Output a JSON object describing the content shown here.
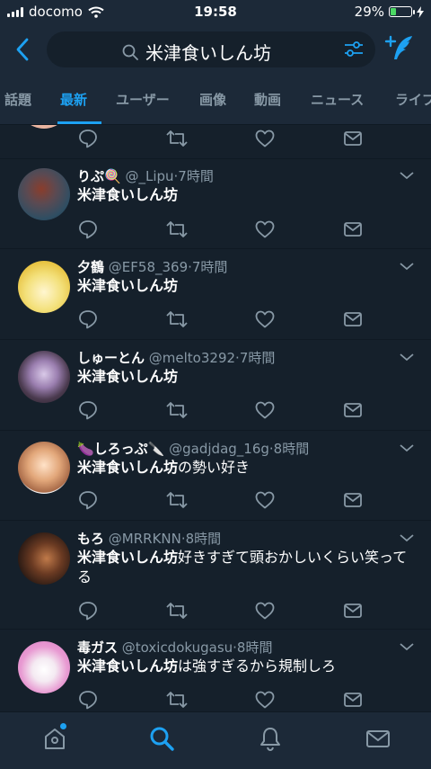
{
  "status": {
    "carrier": "docomo",
    "time": "19:58",
    "battery": "29%"
  },
  "search": {
    "query": "米津食いしん坊"
  },
  "tabs": [
    "話題",
    "最新",
    "ユーザー",
    "画像",
    "動画",
    "ニュース",
    "ライブ"
  ],
  "active_tab": "最新",
  "tweets": [
    {
      "name": "りぷ🍭",
      "handle": "@_Lipu",
      "time": "·7時間",
      "bold": "米津食いしん坊",
      "rest": ""
    },
    {
      "name": "夕鶴",
      "handle": "@EF58_369",
      "time": "·7時間",
      "bold": "米津食いしん坊",
      "rest": ""
    },
    {
      "name": "しゅーとん",
      "handle": "@melto3292",
      "time": "·7時間",
      "bold": "米津食いしん坊",
      "rest": ""
    },
    {
      "name": "🍆しろっぷ🔪",
      "handle": "@gadjdag_16g",
      "time": "·8時間",
      "bold": "米津食いしん坊",
      "rest": "の勢い好き"
    },
    {
      "name": "もろ",
      "handle": "@MRRKNN",
      "time": "·8時間",
      "bold": "米津食いしん坊",
      "rest": "好きすぎて頭おかしいくらい笑ってる"
    },
    {
      "name": "毒ガス",
      "handle": "@toxicdokugasu",
      "time": "·8時間",
      "bold": "米津食いしん坊",
      "rest": "は強すぎるから規制しろ"
    }
  ],
  "colors": {
    "background": "#15202b",
    "bar": "#1c2938",
    "accent": "#1da1f2",
    "secondary": "#8899a6"
  },
  "icons": [
    "back-icon",
    "search-icon",
    "filter-icon",
    "compose-icon",
    "reply-icon",
    "retweet-icon",
    "like-icon",
    "dm-icon",
    "chevron-down-icon",
    "home-icon",
    "notifications-icon",
    "messages-icon"
  ]
}
